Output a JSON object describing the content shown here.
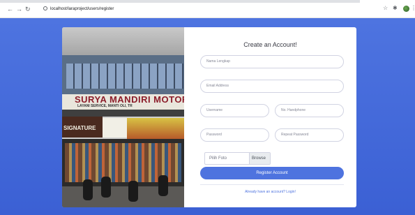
{
  "browser": {
    "back_icon": "arrow-left-icon",
    "forward_icon": "arrow-right-icon",
    "reload_icon": "reload-icon",
    "url": "localhost/laraproject/users/register",
    "star_icon": "star-icon",
    "extensions_icon": "puzzle-icon",
    "menu_icon": "kebab-menu-icon"
  },
  "colors": {
    "accent": "#4e73df",
    "background": "#4e73df",
    "card": "#ffffff"
  },
  "photo": {
    "sign_main": "SURYA MANDIRI MOTOR",
    "sign_sub": "LAYANI SERVICE, MANTI OLI, TR",
    "sign_left": "SIGNATURE"
  },
  "form": {
    "title": "Create an Account!",
    "fields": {
      "first_name": "Nama Lengkap",
      "email": "Email Address",
      "username": "Username",
      "phone": "No. Handphone",
      "password": "Password",
      "repeat_password": "Repeat Password"
    },
    "file_label": "Pilih Foto",
    "browse_label": "Browse",
    "submit_label": "Register Account",
    "login_link": "Already have an account? Login!"
  }
}
